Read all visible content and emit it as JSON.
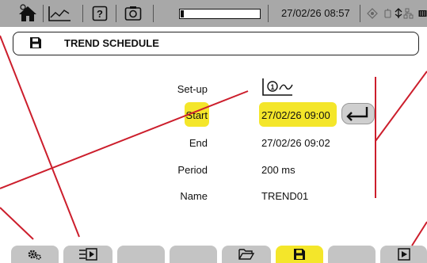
{
  "statusbar": {
    "datetime": "27/02/26 08:57",
    "battery_level": 0.04,
    "icons": [
      "home-icon",
      "trend-icon",
      "help-icon",
      "camera-icon",
      "gps-icon",
      "usb-network-icon",
      "memory-icon"
    ]
  },
  "title": {
    "icon": "floppy-disk-icon",
    "text": "TREND SCHEDULE"
  },
  "form": {
    "setup_label": "Set-up",
    "setup_icon": "trend-setup-1-icon",
    "start_label": "Start",
    "start_value": "27/02/26 09:00",
    "end_label": "End",
    "end_value": "27/02/26 09:02",
    "period_label": "Period",
    "period_value": "200 ms",
    "name_label": "Name",
    "name_value": "TREND01"
  },
  "fkeys": [
    {
      "icon": "settings-icon"
    },
    {
      "icon": "align-play-icon"
    },
    {
      "icon": ""
    },
    {
      "icon": ""
    },
    {
      "icon": "open-folder-icon"
    },
    {
      "icon": "save-icon",
      "active": true
    },
    {
      "icon": ""
    },
    {
      "icon": "play-icon"
    }
  ],
  "colors": {
    "highlight": "#f4e62a",
    "annotation": "#cc1e2c",
    "statusbar": "#a8a8a8"
  }
}
